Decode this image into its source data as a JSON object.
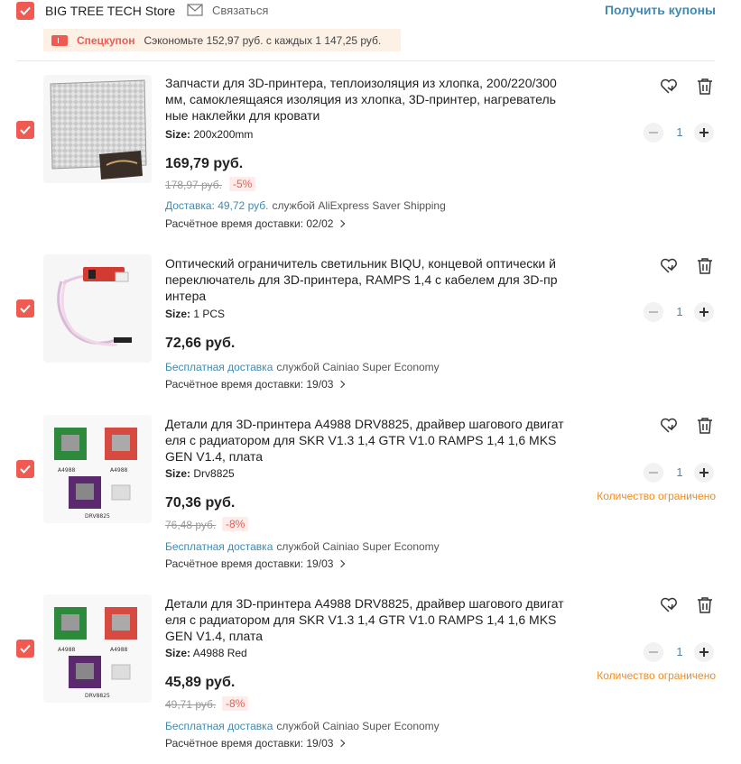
{
  "store": {
    "name": "BIG TREE TECH Store",
    "contact_label": "Связаться",
    "coupons_link": "Получить купоны"
  },
  "coupon": {
    "label": "Спецкупон",
    "text": "Сэкономьте 152,97 руб. с каждых 1 147,25 руб."
  },
  "colors": {
    "accent_red": "#f05a50",
    "link_blue": "#3f8ab4",
    "limited_orange": "#f28b1b"
  },
  "items": [
    {
      "title": "Запчасти для 3D-принтера, теплоизоляция из хлопка, 200/220/300 мм, самоклеящаяся изоляция из хлопка, 3D-принтер, нагреватель ные наклейки для кровати",
      "sku_label": "Size:",
      "sku_value": "200x200mm",
      "price": "169,79 руб.",
      "old_price": "178,97 руб.",
      "discount": "-5%",
      "shipping_label": "Доставка: 49,72 руб.",
      "shipping_service": "службой AliExpress Saver Shipping",
      "eta": "Расчётное время доставки: 02/02",
      "quantity": "1",
      "limited": ""
    },
    {
      "title": "Оптический ограничитель светильник BIQU, концевой оптически й переключатель для 3D-принтера, RAMPS 1,4 с кабелем для 3D-пр интера",
      "sku_label": "Size:",
      "sku_value": "1 PCS",
      "price": "72,66 руб.",
      "old_price": "",
      "discount": "",
      "shipping_label": "Бесплатная доставка",
      "shipping_service": "службой Cainiao Super Economy",
      "eta": "Расчётное время доставки: 19/03",
      "quantity": "1",
      "limited": ""
    },
    {
      "title": "Детали для 3D-принтера A4988 DRV8825, драйвер шагового двигат еля с радиатором для SKR V1.3 1,4 GTR V1.0 RAMPS 1,4 1,6 MKS GEN V1.4, плата",
      "sku_label": "Size:",
      "sku_value": "Drv8825",
      "price": "70,36 руб.",
      "old_price": "76,48 руб.",
      "discount": "-8%",
      "shipping_label": "Бесплатная доставка",
      "shipping_service": "службой Cainiao Super Economy",
      "eta": "Расчётное время доставки: 19/03",
      "quantity": "1",
      "limited": "Количество ограничено"
    },
    {
      "title": "Детали для 3D-принтера A4988 DRV8825, драйвер шагового двигат еля с радиатором для SKR V1.3 1,4 GTR V1.0 RAMPS 1,4 1,6 MKS GEN V1.4, плата",
      "sku_label": "Size:",
      "sku_value": "A4988 Red",
      "price": "45,89 руб.",
      "old_price": "49,71 руб.",
      "discount": "-8%",
      "shipping_label": "Бесплатная доставка",
      "shipping_service": "службой Cainiao Super Economy",
      "eta": "Расчётное время доставки: 19/03",
      "quantity": "1",
      "limited": "Количество ограничено"
    }
  ],
  "thumb_labels": {
    "a4988": "A4988",
    "drv8825": "DRV8825"
  }
}
